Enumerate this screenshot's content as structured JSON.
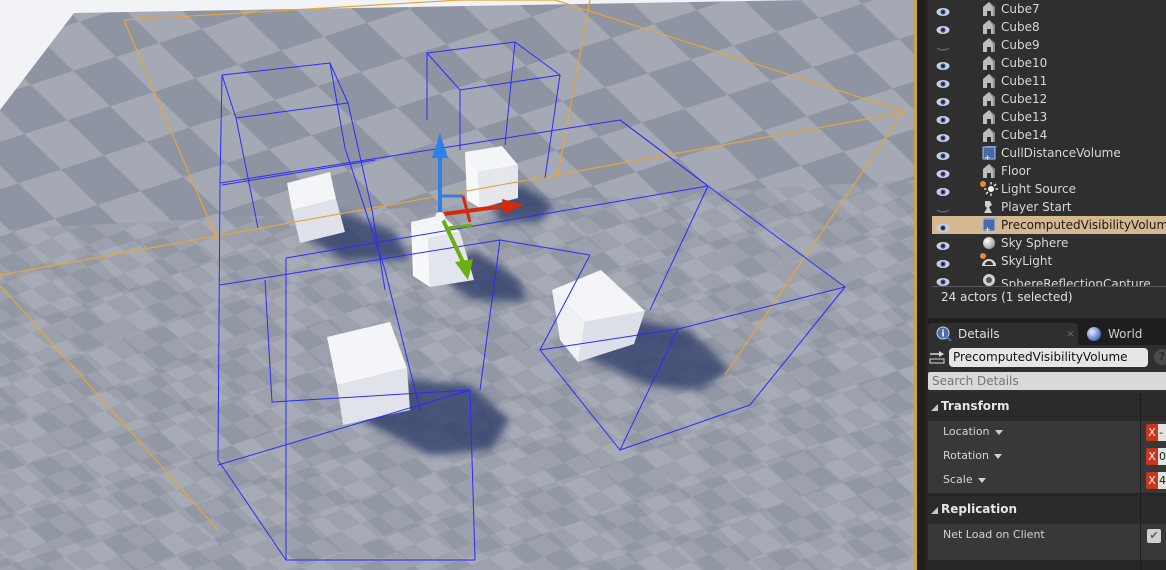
{
  "outliner": {
    "rows": [
      {
        "label": "Cube7",
        "visible": true,
        "type": "static-mesh"
      },
      {
        "label": "Cube8",
        "visible": true,
        "type": "static-mesh"
      },
      {
        "label": "Cube9",
        "visible": false,
        "type": "static-mesh"
      },
      {
        "label": "Cube10",
        "visible": true,
        "type": "static-mesh"
      },
      {
        "label": "Cube11",
        "visible": true,
        "type": "static-mesh"
      },
      {
        "label": "Cube12",
        "visible": true,
        "type": "static-mesh"
      },
      {
        "label": "Cube13",
        "visible": true,
        "type": "static-mesh"
      },
      {
        "label": "Cube14",
        "visible": true,
        "type": "static-mesh"
      },
      {
        "label": "CullDistanceVolume",
        "visible": true,
        "type": "volume"
      },
      {
        "label": "Floor",
        "visible": true,
        "type": "static-mesh"
      },
      {
        "label": "Light Source",
        "visible": true,
        "type": "directional-light"
      },
      {
        "label": "Player Start",
        "visible": false,
        "type": "player-start"
      },
      {
        "label": "PrecomputedVisibilityVolume",
        "visible": true,
        "type": "volume",
        "selected": true
      },
      {
        "label": "Sky Sphere",
        "visible": true,
        "type": "sphere"
      },
      {
        "label": "SkyLight",
        "visible": true,
        "type": "sky-light"
      },
      {
        "label": "SphereReflectionCapture",
        "visible": true,
        "type": "reflection-capture"
      }
    ],
    "footer": "24 actors (1 selected)"
  },
  "tabs": {
    "details": "Details",
    "details_close": "×",
    "world_settings": "World Setti"
  },
  "details": {
    "actor_name": "PrecomputedVisibilityVolume",
    "help": "?",
    "search_placeholder": "Search Details",
    "categories": [
      {
        "label": "Transform",
        "properties": [
          {
            "label": "Location",
            "axis": "X",
            "value": "-"
          },
          {
            "label": "Rotation",
            "axis": "X",
            "value": "0"
          },
          {
            "label": "Scale",
            "axis": "X",
            "value": "4"
          }
        ]
      },
      {
        "label": "Replication",
        "properties": [
          {
            "label": "Net Load on Client",
            "checked": true,
            "check_glyph": "✔"
          }
        ]
      }
    ]
  },
  "viewport": {
    "selection_color": "#f5a623",
    "volume_wire_color": "#2b2bff",
    "gizmo_colors": {
      "x": "#d42a0c",
      "y": "#6aae0f",
      "z": "#2e7fe8"
    }
  }
}
